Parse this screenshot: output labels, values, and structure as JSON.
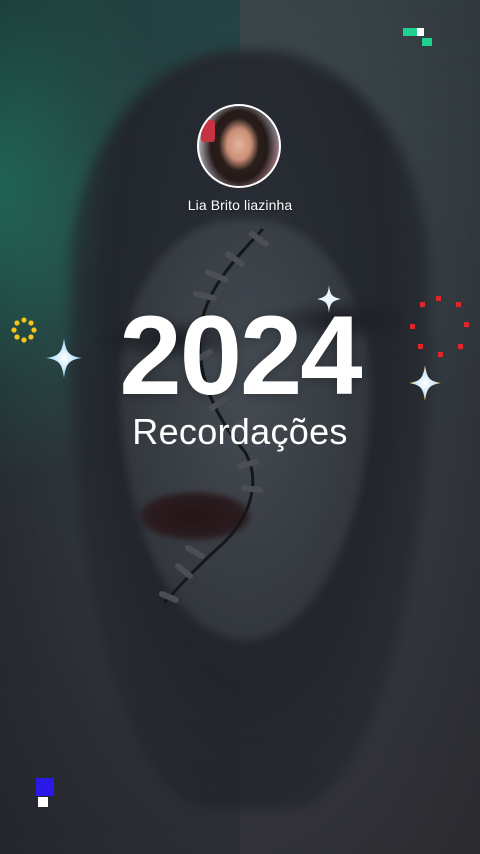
{
  "profile": {
    "username": "Lia Brito liazinha",
    "avatar_icon": "avatar-photo"
  },
  "headline": {
    "year": "2024",
    "subtitle": "Recordações"
  },
  "decorations": {
    "sparkle_color": "#ffffff",
    "sparkle_glow": "#8fd3ff",
    "pixel_green": "#1ed18e",
    "pixel_blue": "#2a18e8",
    "dot_ring_yellow": "#f3c61a",
    "dot_ring_red": "#e0262b"
  }
}
